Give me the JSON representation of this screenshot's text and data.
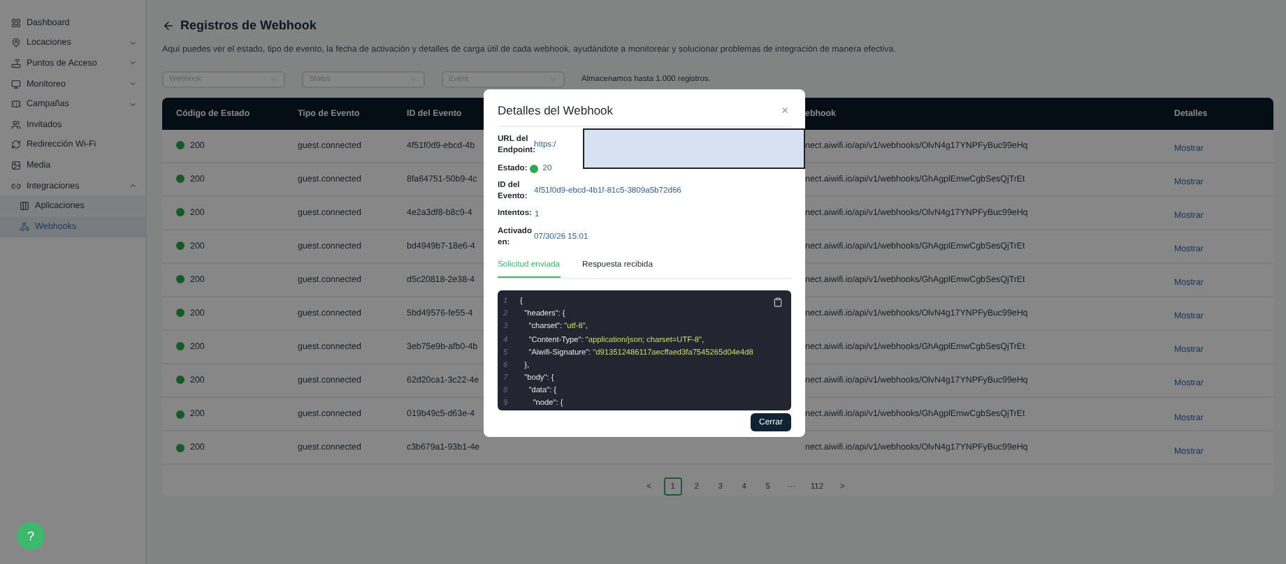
{
  "sidebar": {
    "items": [
      {
        "label": "Dashboard",
        "selected": false
      },
      {
        "label": "Locaciones",
        "expanded": false,
        "selected": false
      },
      {
        "label": "Puntos de Acceso",
        "expanded": false,
        "selected": false
      },
      {
        "label": "Monitoreo",
        "expanded": false,
        "selected": false
      },
      {
        "label": "Campañas",
        "expanded": false,
        "selected": false
      },
      {
        "label": "Invitados",
        "selected": false
      },
      {
        "label": "Redirección Wi-Fi",
        "selected": false
      },
      {
        "label": "Media",
        "selected": false
      },
      {
        "label": "Integraciones",
        "expanded": true,
        "selected": false,
        "children": [
          {
            "label": "Aplicaciones",
            "selected": false
          },
          {
            "label": "Webhooks",
            "selected": true
          }
        ]
      }
    ]
  },
  "page": {
    "title": "Registros de Webhook",
    "description": "Aquí puedes ver el estado, tipo de evento, la fecha de activación y detalles de carga útil de cada webhook, ayudándote a monitorear y solucionar problemas de integración de manera efectiva.",
    "filters": [
      {
        "placeholder": "Webhook"
      },
      {
        "placeholder": "Status"
      },
      {
        "placeholder": "Event"
      }
    ],
    "storage_note": "Almacenamos hasta 1.000 registros."
  },
  "table": {
    "columns": [
      "Código de Estado",
      "Tipo de Evento",
      "ID del Evento",
      "ebhook",
      "Detalles"
    ],
    "rows": [
      {
        "status": "200",
        "event": "guest.connected",
        "id": "4f51f0d9-ebcd-4b",
        "webhook": "nect.aiwifi.io/api/v1/webhooks/OlvN4g17YNPFyBuc99eHq",
        "action": "Mostrar"
      },
      {
        "status": "200",
        "event": "guest.connected",
        "id": "8fa64751-50b9-4c",
        "webhook": "nect.aiwifi.io/api/v1/webhooks/GhAgplEmwCgbSesQjTrEt",
        "action": "Mostrar"
      },
      {
        "status": "200",
        "event": "guest.connected",
        "id": "4e2a3df8-b8c9-4",
        "webhook": "nect.aiwifi.io/api/v1/webhooks/OlvN4g17YNPFyBuc99eHq",
        "action": "Mostrar"
      },
      {
        "status": "200",
        "event": "guest.connected",
        "id": "bd4949b7-18e6-4",
        "webhook": "nect.aiwifi.io/api/v1/webhooks/GhAgplEmwCgbSesQjTrEt",
        "action": "Mostrar"
      },
      {
        "status": "200",
        "event": "guest.connected",
        "id": "d5c20818-2e38-4",
        "webhook": "nect.aiwifi.io/api/v1/webhooks/GhAgplEmwCgbSesQjTrEt",
        "action": "Mostrar"
      },
      {
        "status": "200",
        "event": "guest.connected",
        "id": "5bd49576-fe55-4",
        "webhook": "nect.aiwifi.io/api/v1/webhooks/OlvN4g17YNPFyBuc99eHq",
        "action": "Mostrar"
      },
      {
        "status": "200",
        "event": "guest.connected",
        "id": "3eb75e9b-afb0-4b",
        "webhook": "nect.aiwifi.io/api/v1/webhooks/GhAgplEmwCgbSesQjTrEt",
        "action": "Mostrar"
      },
      {
        "status": "200",
        "event": "guest.connected",
        "id": "62d20ca1-3c22-4e",
        "webhook": "nect.aiwifi.io/api/v1/webhooks/OlvN4g17YNPFyBuc99eHq",
        "action": "Mostrar"
      },
      {
        "status": "200",
        "event": "guest.connected",
        "id": "019b49c5-d63e-4",
        "webhook": "nect.aiwifi.io/api/v1/webhooks/GhAgplEmwCgbSesQjTrEt",
        "action": "Mostrar"
      },
      {
        "status": "200",
        "event": "guest.connected",
        "id": "c3b679a1-93b1-4e",
        "webhook": "nect.aiwifi.io/api/v1/webhooks/OlvN4g17YNPFyBuc99eHq",
        "action": "Mostrar"
      }
    ]
  },
  "pagination": {
    "prev": "<",
    "next": ">",
    "pages": [
      {
        "label": "1",
        "selected": true
      },
      {
        "label": "2",
        "selected": false
      },
      {
        "label": "3",
        "selected": false
      },
      {
        "label": "4",
        "selected": false
      },
      {
        "label": "5",
        "selected": false
      },
      {
        "label": "···",
        "selected": false
      },
      {
        "label": "112",
        "selected": false
      }
    ]
  },
  "help_button": "?",
  "modal": {
    "title": "Detalles del Webhook",
    "close": "×",
    "fields": [
      {
        "label": "URL del Endpoint:",
        "value": "https:/",
        "kind": "link"
      },
      {
        "label": "Estado:",
        "value": "20",
        "kind": "status"
      },
      {
        "label": "ID del Evento:",
        "value": "4f51f0d9-ebcd-4b1f-81c5-3809a5b72d66",
        "kind": "link"
      },
      {
        "label": "Intentos:",
        "value": "1",
        "kind": "link"
      },
      {
        "label": "Activado en:",
        "value": "07/30/26 15:01",
        "kind": "link"
      }
    ],
    "tabs": [
      {
        "label": "Solicitud enviada",
        "selected": true
      },
      {
        "label": "Respuesta recibida",
        "selected": false
      }
    ],
    "code_lines": [
      {
        "number": "1",
        "parts": [
          {
            "text": "{",
            "kind": "plain"
          }
        ]
      },
      {
        "number": "2",
        "parts": [
          {
            "text": "  \"headers\": {",
            "kind": "plain"
          }
        ]
      },
      {
        "number": "3",
        "parts": [
          {
            "text": "    \"charset\": ",
            "kind": "plain"
          },
          {
            "text": "\"utf-8\"",
            "kind": "string"
          },
          {
            "text": ",",
            "kind": "plain"
          }
        ]
      },
      {
        "number": "4",
        "parts": [
          {
            "text": "    \"Content-Type\": ",
            "kind": "plain"
          },
          {
            "text": "\"application/json; charset=UTF-8\"",
            "kind": "string"
          },
          {
            "text": ",",
            "kind": "plain"
          }
        ]
      },
      {
        "number": "5",
        "parts": [
          {
            "text": "    \"Aiwifi-Signature\": ",
            "kind": "plain"
          },
          {
            "text": "\"d913512486117aecffaed3fa7545265d04e4d8",
            "kind": "string"
          }
        ]
      },
      {
        "number": "6",
        "parts": [
          {
            "text": "  },",
            "kind": "plain"
          }
        ]
      },
      {
        "number": "7",
        "parts": [
          {
            "text": "  \"body\": {",
            "kind": "plain"
          }
        ]
      },
      {
        "number": "8",
        "parts": [
          {
            "text": "    \"data\": {",
            "kind": "plain"
          }
        ]
      },
      {
        "number": "9",
        "parts": [
          {
            "text": "      \"node\": {",
            "kind": "plain"
          }
        ]
      }
    ],
    "close_button": "Cerrar"
  }
}
